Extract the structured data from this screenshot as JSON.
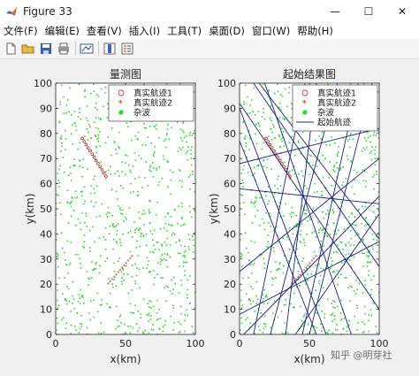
{
  "window": {
    "title": "Figure 33"
  },
  "window_controls": {
    "minimize": "—",
    "maximize": "☐",
    "close": "✕"
  },
  "menu": [
    "文件(F)",
    "编辑(E)",
    "查看(V)",
    "插入(I)",
    "工具(T)",
    "桌面(D)",
    "窗口(W)",
    "帮助(H)"
  ],
  "toolbar_icons": [
    "new-figure-icon",
    "open-file-icon",
    "save-icon",
    "print-icon",
    "link-plot-icon",
    "colorbar-icon",
    "legend-icon"
  ],
  "watermark": "知乎 @明芽社",
  "chart_data": [
    {
      "type": "scatter",
      "title": "量测图",
      "xlabel": "x(km)",
      "ylabel": "y(km)",
      "xlim": [
        0,
        100
      ],
      "ylim": [
        0,
        100
      ],
      "xticks": [
        "0",
        "50",
        "100"
      ],
      "yticks": [
        "0",
        "10",
        "20",
        "30",
        "40",
        "50",
        "60",
        "70",
        "80",
        "90",
        "100"
      ],
      "legend_position": "top-right",
      "legend": [
        {
          "label": "真实航迹1",
          "marker": "circle-open",
          "color": "#d04040"
        },
        {
          "label": "真实航迹2",
          "marker": "asterisk",
          "color": "#b03030"
        },
        {
          "label": "杂波",
          "marker": "dot-filled",
          "color": "#22dd22"
        }
      ],
      "series": [
        {
          "name": "真实航迹1",
          "start": [
            19,
            78
          ],
          "end": [
            36,
            63
          ],
          "color": "#b03030"
        },
        {
          "name": "真实航迹2",
          "start": [
            38,
            20
          ],
          "end": [
            55,
            31
          ],
          "color": "#b03030"
        },
        {
          "name": "杂波",
          "color": "#22dd22",
          "distribution": "uniform-random",
          "approx_count": 800
        }
      ]
    },
    {
      "type": "line",
      "title": "起始结果图",
      "xlabel": "x(km)",
      "ylabel": "y(km)",
      "xlim": [
        0,
        100
      ],
      "ylim": [
        0,
        100
      ],
      "xticks": [
        "0",
        "50",
        "100"
      ],
      "yticks": [
        "0",
        "10",
        "20",
        "30",
        "40",
        "50",
        "60",
        "70",
        "80",
        "90",
        "100"
      ],
      "legend_position": "top-right",
      "legend": [
        {
          "label": "真实航迹1",
          "marker": "circle-open",
          "color": "#d04040"
        },
        {
          "label": "真实航迹2",
          "marker": "asterisk",
          "color": "#b03030"
        },
        {
          "label": "杂波",
          "marker": "dot-filled",
          "color": "#22dd22"
        },
        {
          "label": "起始航迹",
          "marker": "line",
          "color": "#1a1f8a"
        }
      ],
      "true_tracks": [
        {
          "start": [
            19,
            78
          ],
          "end": [
            36,
            63
          ]
        },
        {
          "start": [
            38,
            20
          ],
          "end": [
            55,
            31
          ]
        }
      ],
      "initiated_tracks": [
        {
          "start": [
            0,
            92
          ],
          "end": [
            100,
            10
          ]
        },
        {
          "start": [
            0,
            90
          ],
          "end": [
            62,
            0
          ]
        },
        {
          "start": [
            10,
            100
          ],
          "end": [
            100,
            27
          ]
        },
        {
          "start": [
            14,
            100
          ],
          "end": [
            100,
            38
          ]
        },
        {
          "start": [
            18,
            100
          ],
          "end": [
            80,
            0
          ]
        },
        {
          "start": [
            0,
            77
          ],
          "end": [
            55,
            0
          ]
        },
        {
          "start": [
            0,
            68
          ],
          "end": [
            100,
            82
          ]
        },
        {
          "start": [
            10,
            0
          ],
          "end": [
            47,
            100
          ]
        },
        {
          "start": [
            22,
            0
          ],
          "end": [
            70,
            100
          ]
        },
        {
          "start": [
            33,
            0
          ],
          "end": [
            55,
            100
          ]
        },
        {
          "start": [
            45,
            0
          ],
          "end": [
            85,
            100
          ]
        },
        {
          "start": [
            50,
            0
          ],
          "end": [
            95,
            100
          ]
        },
        {
          "start": [
            0,
            25
          ],
          "end": [
            100,
            70
          ]
        },
        {
          "start": [
            0,
            58
          ],
          "end": [
            100,
            52
          ]
        },
        {
          "start": [
            3,
            0
          ],
          "end": [
            100,
            55
          ]
        },
        {
          "start": [
            40,
            0
          ],
          "end": [
            100,
            48
          ]
        },
        {
          "start": [
            0,
            8
          ],
          "end": [
            100,
            37
          ]
        }
      ]
    }
  ]
}
